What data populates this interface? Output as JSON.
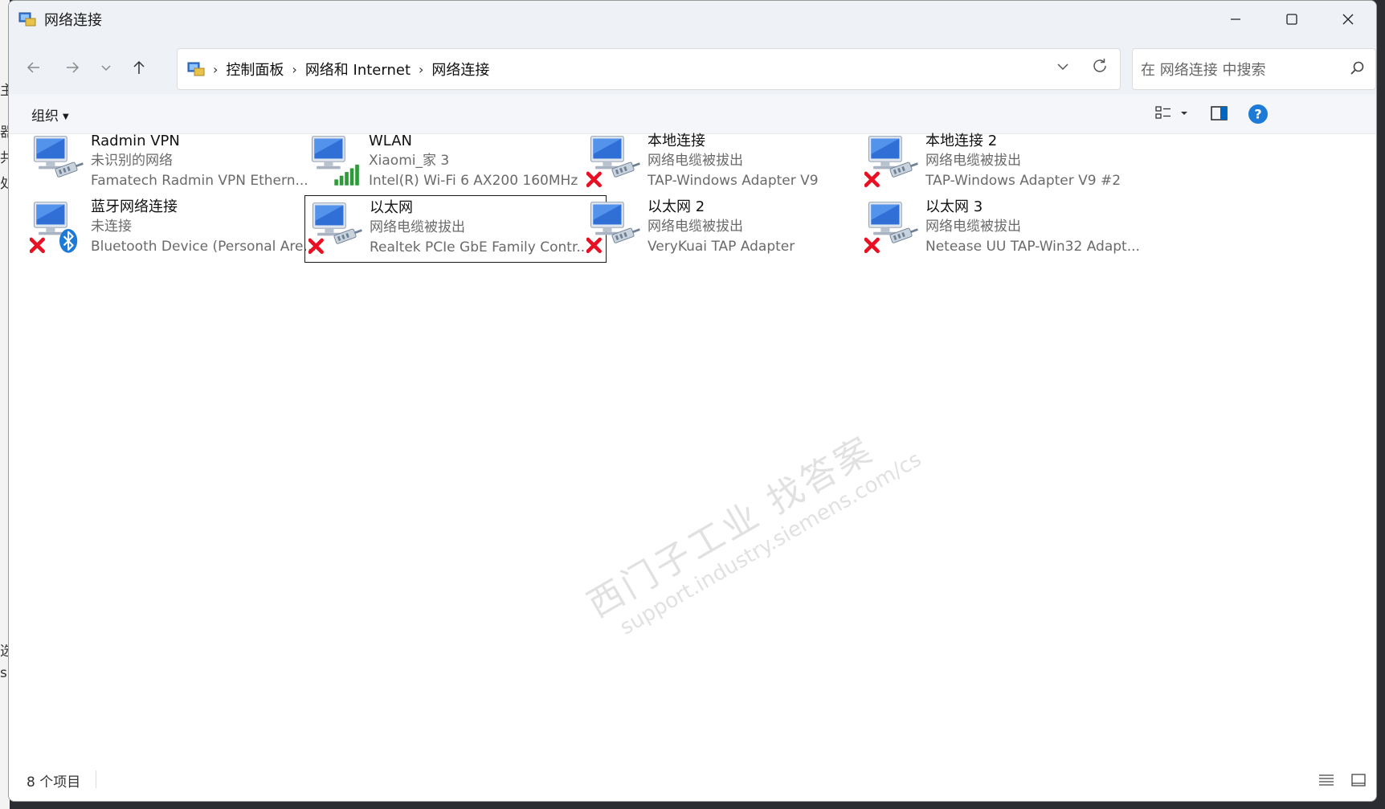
{
  "window": {
    "title": "网络连接",
    "controls": {
      "minimize": "─",
      "maximize": "☐",
      "close": "✕"
    }
  },
  "nav": {
    "back": "←",
    "forward": "→",
    "recent": "⌄",
    "up": "↑",
    "breadcrumb": [
      "控制面板",
      "网络和 Internet",
      "网络连接"
    ],
    "search_placeholder": "在 网络连接 中搜索"
  },
  "toolbar": {
    "organize_label": "组织"
  },
  "background_chars": [
    "主",
    "器",
    "共",
    "处",
    "选",
    "s"
  ],
  "connections": [
    {
      "name": "Radmin VPN",
      "status": "未识别的网络",
      "device": "Famatech Radmin VPN Ethern...",
      "state": "connected",
      "overlay": "none"
    },
    {
      "name": "WLAN",
      "status": "Xiaomi_家 3",
      "device": "Intel(R) Wi-Fi 6 AX200 160MHz",
      "state": "wifi",
      "overlay": "wifi"
    },
    {
      "name": "本地连接",
      "status": "网络电缆被拔出",
      "device": "TAP-Windows Adapter V9",
      "state": "disconnected",
      "overlay": "x"
    },
    {
      "name": "本地连接 2",
      "status": "网络电缆被拔出",
      "device": "TAP-Windows Adapter V9 #2",
      "state": "disconnected",
      "overlay": "x"
    },
    {
      "name": "蓝牙网络连接",
      "status": "未连接",
      "device": "Bluetooth Device (Personal Are...",
      "state": "bluetooth",
      "overlay": "x"
    },
    {
      "name": "以太网",
      "status": "网络电缆被拔出",
      "device": "Realtek PCIe GbE Family Contr...",
      "state": "disconnected",
      "overlay": "x",
      "selected": true
    },
    {
      "name": "以太网 2",
      "status": "网络电缆被拔出",
      "device": "VeryKuai TAP Adapter",
      "state": "disconnected",
      "overlay": "x"
    },
    {
      "name": "以太网 3",
      "status": "网络电缆被拔出",
      "device": "Netease UU TAP-Win32 Adapt...",
      "state": "disconnected",
      "overlay": "x"
    }
  ],
  "watermark": {
    "line1": "西门子工业  找答案",
    "line2": "support.industry.siemens.com/cs"
  },
  "status": {
    "item_count": "8 个项目"
  },
  "colors": {
    "titlebar_bg": "#eef1f6",
    "accent": "#0067c0",
    "error_x": "#e81123",
    "wifi_green": "#2e9b3a"
  }
}
